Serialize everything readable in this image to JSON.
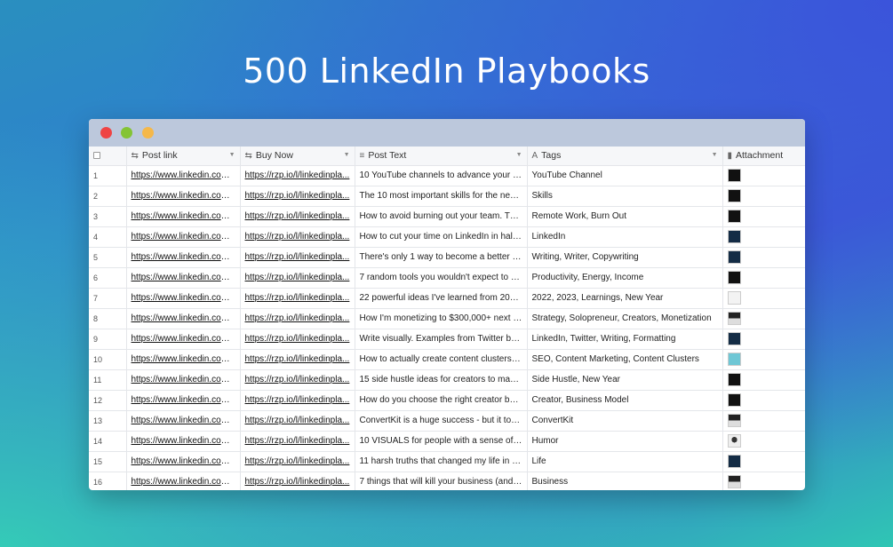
{
  "headline": "500 LinkedIn Playbooks",
  "columns": {
    "post_link": "Post link",
    "buy_now": "Buy Now",
    "post_text": "Post Text",
    "tags": "Tags",
    "attachment": "Attachment"
  },
  "rows": [
    {
      "n": "1",
      "link": "https://www.linkedin.com/...",
      "buy": "https://rzp.io/l/linkedinpla...",
      "text": "10 YouTube channels to advance your le...",
      "tags": "YouTube Channel",
      "thumb": "dark"
    },
    {
      "n": "2",
      "link": "https://www.linkedin.com/...",
      "buy": "https://rzp.io/l/linkedinpla...",
      "text": "The 10 most important skills for the next ...",
      "tags": "Skills",
      "thumb": "dark"
    },
    {
      "n": "3",
      "link": "https://www.linkedin.com/...",
      "buy": "https://rzp.io/l/linkedinpla...",
      "text": "How to avoid burning out your team. The...",
      "tags": "Remote Work, Burn Out",
      "thumb": "dark"
    },
    {
      "n": "4",
      "link": "https://www.linkedin.com/...",
      "buy": "https://rzp.io/l/linkedinpla...",
      "text": "How to cut your time on LinkedIn in half ...",
      "tags": "LinkedIn",
      "thumb": "navy"
    },
    {
      "n": "5",
      "link": "https://www.linkedin.com/...",
      "buy": "https://rzp.io/l/linkedinpla...",
      "text": "There's only 1 way to become a better w...",
      "tags": "Writing, Writer, Copywriting",
      "thumb": "navy"
    },
    {
      "n": "6",
      "link": "https://www.linkedin.com/...",
      "buy": "https://rzp.io/l/linkedinpla...",
      "text": "7 random tools you wouldn't expect to b...",
      "tags": "Productivity, Energy, Income",
      "thumb": "dark"
    },
    {
      "n": "7",
      "link": "https://www.linkedin.com/...",
      "buy": "https://rzp.io/l/linkedinpla...",
      "text": "22 powerful ideas I've learned from 202...",
      "tags": "2022, 2023, Learnings, New Year",
      "thumb": "light"
    },
    {
      "n": "8",
      "link": "https://www.linkedin.com/...",
      "buy": "https://rzp.io/l/linkedinpla...",
      "text": "How I'm monetizing to $300,000+ next y...",
      "tags": "Strategy, Solopreneur, Creators, Monetization",
      "thumb": "mixed"
    },
    {
      "n": "9",
      "link": "https://www.linkedin.com/...",
      "buy": "https://rzp.io/l/linkedinpla...",
      "text": "Write visually. Examples from Twitter but...",
      "tags": "LinkedIn, Twitter, Writing, Formatting",
      "thumb": "navy"
    },
    {
      "n": "10",
      "link": "https://www.linkedin.com/...",
      "buy": "https://rzp.io/l/linkedinpla...",
      "text": "How to actually create content clusters f...",
      "tags": "SEO, Content Marketing, Content Clusters",
      "thumb": "teal"
    },
    {
      "n": "11",
      "link": "https://www.linkedin.com/...",
      "buy": "https://rzp.io/l/linkedinpla...",
      "text": "15 side hustle ideas for creators to make...",
      "tags": "Side Hustle, New Year",
      "thumb": "dark"
    },
    {
      "n": "12",
      "link": "https://www.linkedin.com/...",
      "buy": "https://rzp.io/l/linkedinpla...",
      "text": "How do you choose the right creator bus...",
      "tags": "Creator, Business Model",
      "thumb": "dark"
    },
    {
      "n": "13",
      "link": "https://www.linkedin.com/...",
      "buy": "https://rzp.io/l/linkedinpla...",
      "text": "ConvertKit is a huge success - but it too...",
      "tags": "ConvertKit",
      "thumb": "mixed"
    },
    {
      "n": "14",
      "link": "https://www.linkedin.com/...",
      "buy": "https://rzp.io/l/linkedinpla...",
      "text": "10 VISUALS for people with a sense of h...",
      "tags": "Humor",
      "thumb": "face"
    },
    {
      "n": "15",
      "link": "https://www.linkedin.com/...",
      "buy": "https://rzp.io/l/linkedinpla...",
      "text": "11 harsh truths that changed my life in 2...",
      "tags": "Life",
      "thumb": "navy"
    },
    {
      "n": "16",
      "link": "https://www.linkedin.com/...",
      "buy": "https://rzp.io/l/linkedinpla...",
      "text": "7 things that will kill your business (and ...",
      "tags": "Business",
      "thumb": "mixed"
    }
  ]
}
